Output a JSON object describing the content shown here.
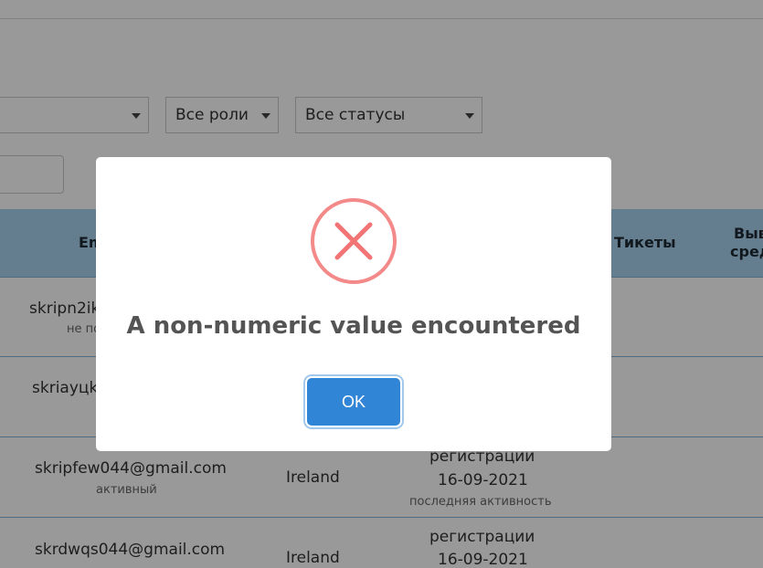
{
  "filters": {
    "roles_select": "Все роли",
    "statuses_select": "Все статусы"
  },
  "table": {
    "headers": {
      "email_partial": "Em",
      "tickets": "Тикеты",
      "right_partial_line1": "Выв",
      "right_partial_line2": "сред"
    },
    "rows": [
      {
        "email": "skripn2ik",
        "status": "не по"
      },
      {
        "email": "skriayцks",
        "status": ""
      },
      {
        "email": "skripfew044@gmail.com",
        "status": "активный",
        "country": "Ireland",
        "reg_label": "регистрации",
        "reg_date": "16-09-2021",
        "activity_label": "последняя активность"
      },
      {
        "email": "skrdwqs044@gmail.com",
        "status": "",
        "country": "Ireland",
        "reg_label": "регистрации",
        "reg_date": "16-09-2021"
      }
    ]
  },
  "modal": {
    "title": "A non-numeric value encountered",
    "ok_label": "OK",
    "icon": "error-x-icon",
    "icon_color": "#f27474",
    "button_color": "#3085d6"
  }
}
